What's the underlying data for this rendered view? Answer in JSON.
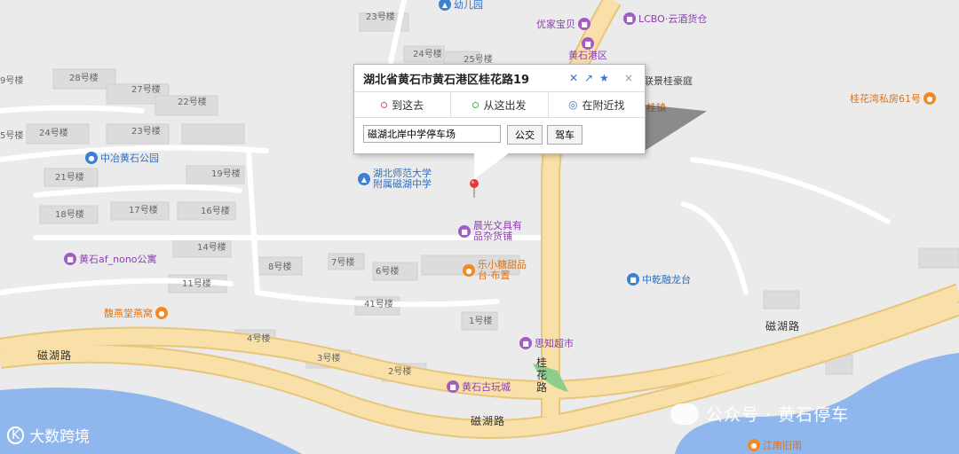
{
  "colors": {
    "background": "#ebebeb",
    "road": "#f9e0a8",
    "road_edge": "#e8c57a",
    "water": "#8fb7ed",
    "block": "#dcdcdc",
    "block_edge": "#cfcfcf"
  },
  "popup": {
    "title": "湖北省黄石市黄石港区桂花路19",
    "icons": {
      "close": "close-icon",
      "share": "share-icon",
      "favorite": "star-icon",
      "dismiss": "×"
    },
    "tabs": [
      {
        "label": "到这去",
        "icon": "route-to-icon"
      },
      {
        "label": "从这出发",
        "icon": "route-from-icon"
      },
      {
        "label": "在附近找",
        "icon": "search-nearby-icon"
      }
    ],
    "input_value": "磁湖北岸中学停车场",
    "btn_bus": "公交",
    "btn_drive": "驾车"
  },
  "roads": {
    "cihu_1": "磁湖路",
    "cihu_2": "磁湖路",
    "cihu_3": "磁湖路",
    "guihua": "桂花路"
  },
  "buildings": [
    "23号楼",
    "24号楼",
    "25号楼",
    "28号楼",
    "27号楼",
    "22号楼",
    "9号楼",
    "24号楼",
    "23号楼",
    "5号楼",
    "21号楼",
    "19号楼",
    "18号楼",
    "17号楼",
    "16号楼",
    "14号楼",
    "8号楼",
    "7号楼",
    "6号楼",
    "11号楼",
    "41号楼",
    "1号楼",
    "4号楼",
    "3号楼",
    "2号楼"
  ],
  "pois": {
    "kindergarten": "幼儿园",
    "youjia": "优家宝贝",
    "lcbo": "LCBO·云酒货仓",
    "huangshigang": "黄石港区",
    "lianjing": "联景桂豪庭",
    "guihuawan": "桂花湾私房61号",
    "zhongye": "中冶黄石公园",
    "school_1": "湖北师范大学",
    "school_2": "附属磁湖中学",
    "chenguang_1": "晨光文具有",
    "chenguang_2": "品杂货铺",
    "af_nono": "黄石af_nono公寓",
    "lexiaotang_1": "乐小糖甜品",
    "lexiaotang_2": "台·布置",
    "zhongqian": "中乾融龙台",
    "yanwo": "馥燕堂燕窝",
    "sisi": "思知超市",
    "guwan": "黄石古玩城",
    "jiangnan": "江南旧雨",
    "guizhen": "桂镇"
  },
  "watermark": {
    "left": "大数跨境",
    "right": "公众号 · 黄石停车"
  }
}
